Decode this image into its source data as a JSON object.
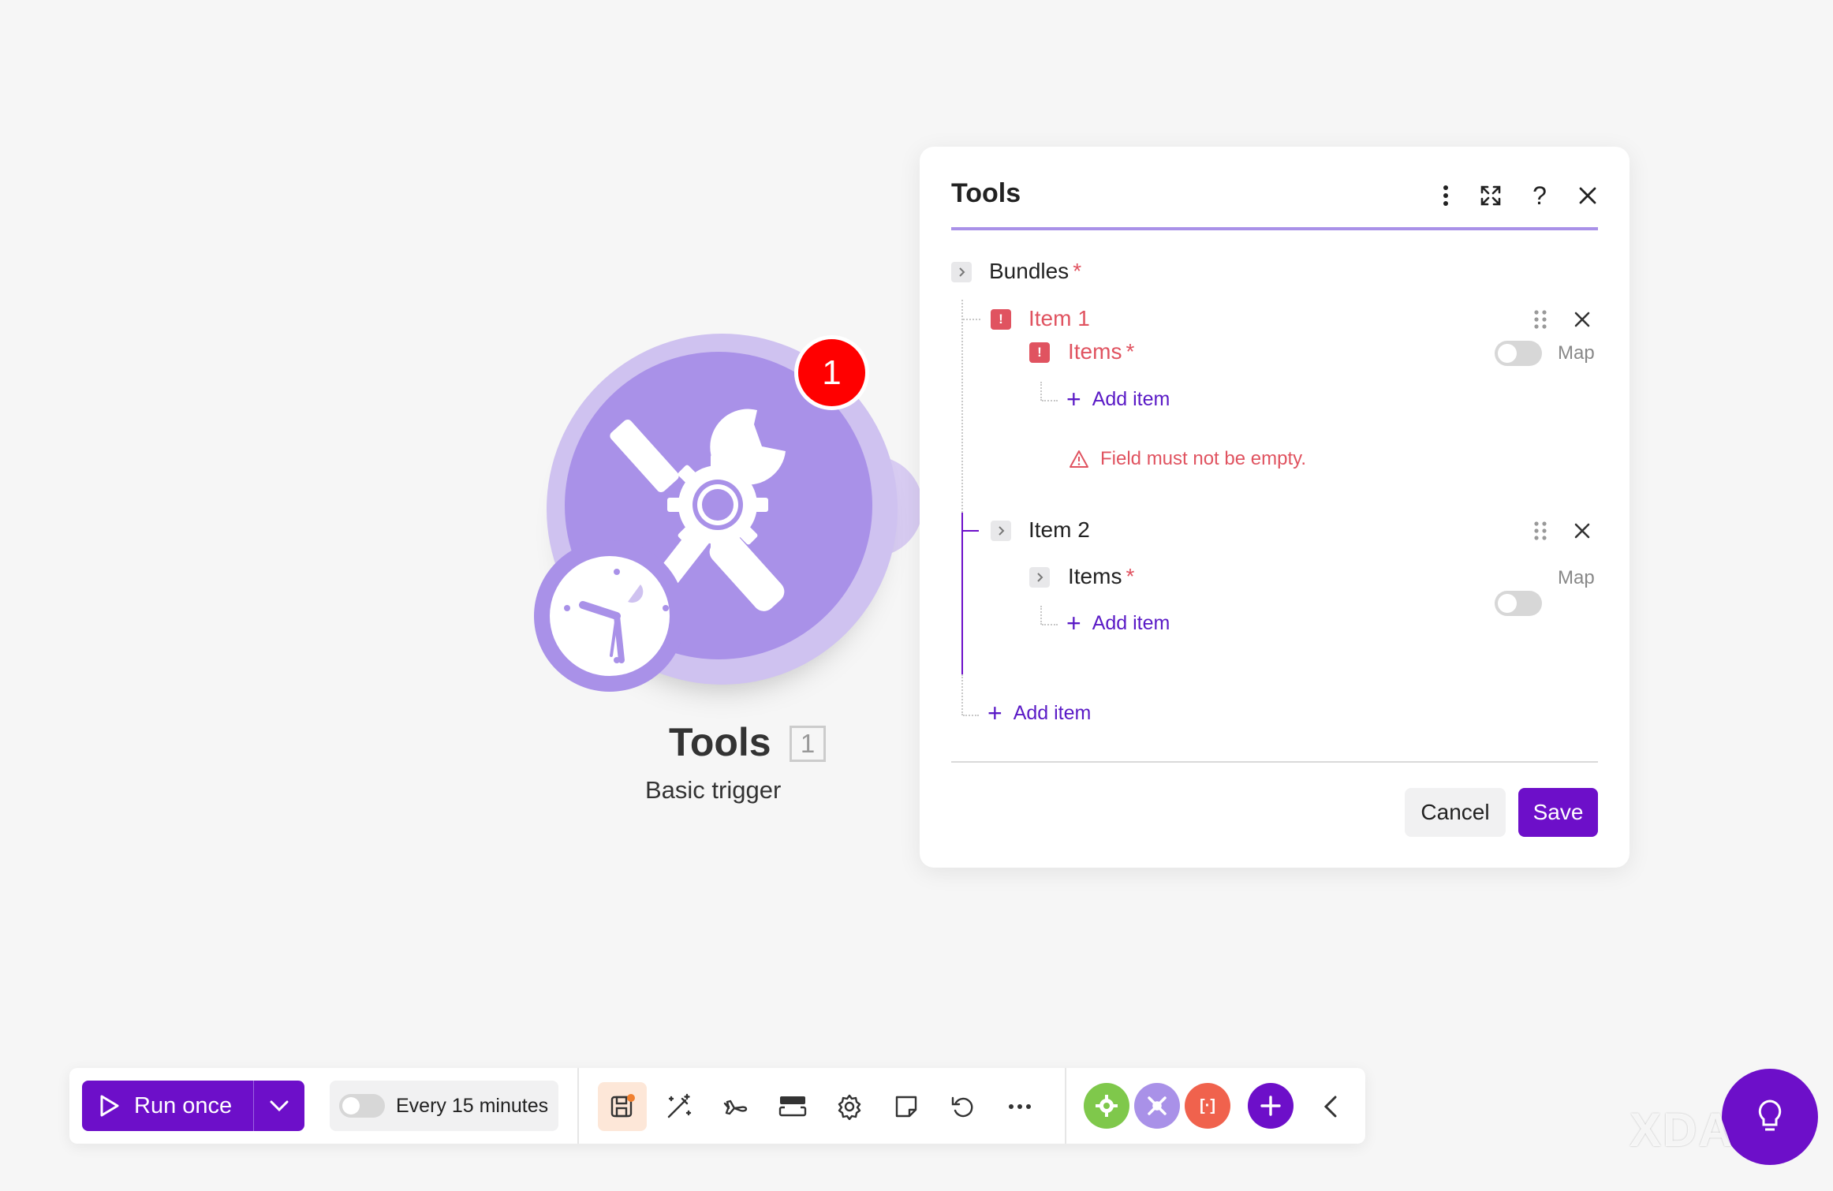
{
  "module": {
    "title": "Tools",
    "id": "1",
    "subtitle": "Basic trigger",
    "badge_count": "1",
    "icon": "tools-icon",
    "trigger_icon": "clock-icon"
  },
  "dialog": {
    "title": "Tools",
    "header_icons": [
      "more-vertical-icon",
      "expand-icon",
      "help-icon",
      "close-icon"
    ],
    "bundles_label": "Bundles",
    "required_mark": "*",
    "items": [
      {
        "label": "Item 1",
        "state": "error",
        "field_label": "Items",
        "map_label": "Map",
        "map_enabled": false,
        "add_item_label": "Add item",
        "error_message": "Field must not be empty."
      },
      {
        "label": "Item 2",
        "state": "collapsed",
        "field_label": "Items",
        "map_label": "Map",
        "map_enabled": false,
        "add_item_label": "Add item"
      }
    ],
    "add_item_label": "Add item",
    "cancel_label": "Cancel",
    "save_label": "Save"
  },
  "toolbar": {
    "run_once_label": "Run once",
    "schedule_label": "Every 15 minutes",
    "schedule_enabled": false,
    "icons": [
      "save-icon",
      "auto-align-icon",
      "airplane-icon",
      "notes-panel-icon",
      "settings-icon",
      "note-icon",
      "undo-icon",
      "more-icon"
    ],
    "apps": [
      {
        "name": "flow-control-icon",
        "color": "#7fc84b"
      },
      {
        "name": "tools-icon",
        "color": "#a991e8"
      },
      {
        "name": "json-icon",
        "color": "#f0624d"
      }
    ],
    "accent_color": "#6d0fc9"
  },
  "watermark": "XDA"
}
